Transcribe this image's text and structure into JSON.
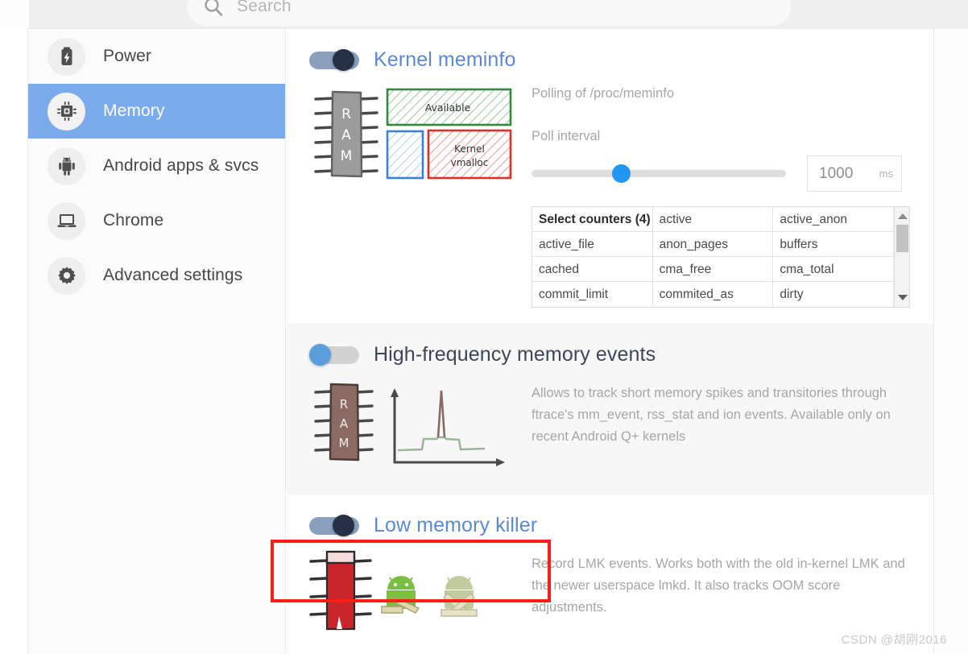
{
  "search": {
    "placeholder": "Search",
    "icon": "search-icon",
    "value": ""
  },
  "sidebar": {
    "items": [
      {
        "label": "Power",
        "icon": "battery-icon",
        "active": false
      },
      {
        "label": "Memory",
        "icon": "chip-icon",
        "active": true
      },
      {
        "label": "Android apps & svcs",
        "icon": "android-icon",
        "active": false
      },
      {
        "label": "Chrome",
        "icon": "laptop-icon",
        "active": false
      },
      {
        "label": "Advanced settings",
        "icon": "gear-icon",
        "active": false
      }
    ]
  },
  "colors": {
    "accent_blue": "#5b89d4",
    "active_row": "#7cabed",
    "toggle_on_track": "#8ba0bd",
    "toggle_on_knob": "#263145",
    "toggle_off_knob": "#5a9fdc",
    "slider_thumb": "#2196f3",
    "highlight_red": "#fc1d17",
    "muted_text": "#a6a6a6"
  },
  "sections": [
    {
      "id": "kernel-meminfo",
      "title": "Kernel meminfo",
      "toggle_state": "on",
      "shaded": false,
      "description": "Polling of /proc/meminfo",
      "poll_interval": {
        "label": "Poll interval",
        "value": "1000",
        "unit": "ms",
        "slider_percent": 35
      },
      "counters": {
        "header": "Select counters (4)",
        "selected_count": 4,
        "rows": [
          [
            "Select counters (4)",
            "active",
            "active_anon"
          ],
          [
            "active_file",
            "anon_pages",
            "buffers"
          ],
          [
            "cached",
            "cma_free",
            "cma_total"
          ],
          [
            "commit_limit",
            "commited_as",
            "dirty"
          ]
        ]
      },
      "art": "ram-meminfo-diagram",
      "art_labels": {
        "chip": "RAM",
        "available": "Available",
        "kernel": "Kernel\nvmalloc"
      }
    },
    {
      "id": "high-frequency-memory-events",
      "title": "High-frequency memory events",
      "toggle_state": "off",
      "shaded": true,
      "description": "Allows to track short memory spikes and transitories through ftrace's mm_event, rss_stat and ion events. Available only on recent Android Q+ kernels",
      "art": "ram-spike-graph",
      "art_labels": {
        "chip": "RAM"
      }
    },
    {
      "id": "low-memory-killer",
      "title": "Low memory killer",
      "toggle_state": "on",
      "shaded": false,
      "highlighted": true,
      "description": "Record LMK events. Works both with the old in-kernel LMK and the newer userspace lmkd. It also tracks OOM score adjustments.",
      "art": "lmk-android-diagram"
    }
  ],
  "watermark": "CSDN @胡刚2016"
}
